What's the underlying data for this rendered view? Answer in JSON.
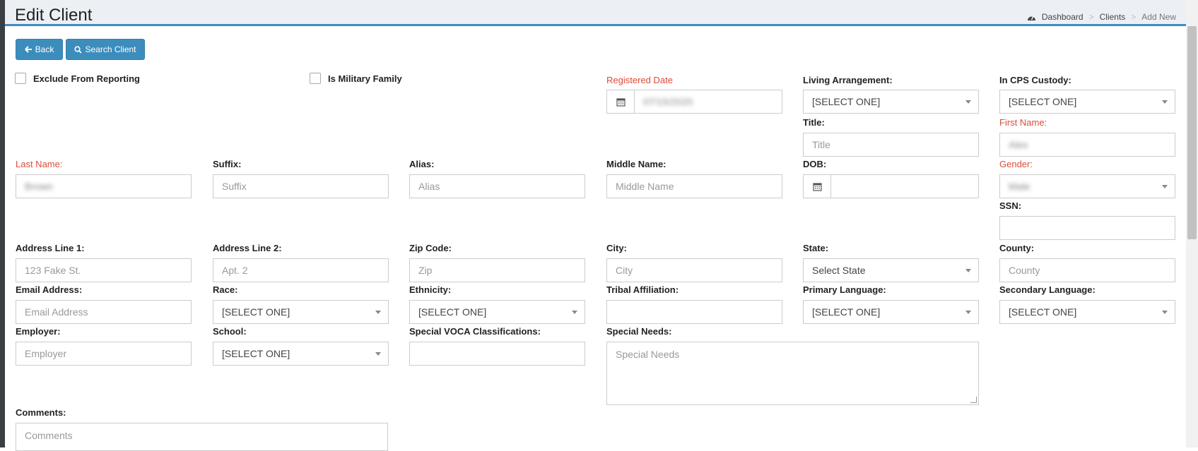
{
  "header": {
    "title": "Edit Client",
    "breadcrumb": {
      "dashboard": "Dashboard",
      "clients": "Clients",
      "current": "Add New",
      "separator": ">"
    }
  },
  "toolbar": {
    "back_label": "Back",
    "search_label": "Search Client"
  },
  "checkboxes": {
    "exclude_reporting": "Exclude From Reporting",
    "military_family": "Is Military Family"
  },
  "fields": {
    "registered_date": {
      "label": "Registered Date",
      "value": "07/15/2020"
    },
    "living_arrangement": {
      "label": "Living Arrangement:",
      "value": "[SELECT ONE]"
    },
    "cps_custody": {
      "label": "In CPS Custody:",
      "value": "[SELECT ONE]"
    },
    "title": {
      "label": "Title:",
      "placeholder": "Title"
    },
    "first_name": {
      "label": "First Name:",
      "value": "Alex"
    },
    "last_name": {
      "label": "Last Name:",
      "value": "Brown"
    },
    "suffix": {
      "label": "Suffix:",
      "placeholder": "Suffix"
    },
    "alias": {
      "label": "Alias:",
      "placeholder": "Alias"
    },
    "middle_name": {
      "label": "Middle Name:",
      "placeholder": "Middle Name"
    },
    "dob": {
      "label": "DOB:",
      "value": ""
    },
    "gender": {
      "label": "Gender:",
      "value": "Male"
    },
    "ssn": {
      "label": "SSN:",
      "value": ""
    },
    "address1": {
      "label": "Address Line 1:",
      "placeholder": "123 Fake St."
    },
    "address2": {
      "label": "Address Line 2:",
      "placeholder": "Apt. 2"
    },
    "zip": {
      "label": "Zip Code:",
      "placeholder": "Zip"
    },
    "city": {
      "label": "City:",
      "placeholder": "City"
    },
    "state": {
      "label": "State:",
      "value": "Select State"
    },
    "county": {
      "label": "County:",
      "placeholder": "County"
    },
    "email": {
      "label": "Email Address:",
      "placeholder": "Email Address"
    },
    "race": {
      "label": "Race:",
      "value": "[SELECT ONE]"
    },
    "ethnicity": {
      "label": "Ethnicity:",
      "value": "[SELECT ONE]"
    },
    "tribal": {
      "label": "Tribal Affiliation:",
      "value": ""
    },
    "primary_language": {
      "label": "Primary Language:",
      "value": "[SELECT ONE]"
    },
    "secondary_language": {
      "label": "Secondary Language:",
      "value": "[SELECT ONE]"
    },
    "employer": {
      "label": "Employer:",
      "placeholder": "Employer"
    },
    "school": {
      "label": "School:",
      "value": "[SELECT ONE]"
    },
    "voca": {
      "label": "Special VOCA Classifications:",
      "value": ""
    },
    "special_needs": {
      "label": "Special Needs:",
      "placeholder": "Special Needs"
    },
    "comments": {
      "label": "Comments:",
      "placeholder": "Comments"
    }
  },
  "icons": {
    "back": "arrow-left-icon",
    "search": "search-icon",
    "calendar": "calendar-icon",
    "dashboard": "dashboard-icon"
  },
  "colors": {
    "primary": "#3c8dbc",
    "required": "#dd4b39",
    "header_bg": "#ecf0f5"
  }
}
